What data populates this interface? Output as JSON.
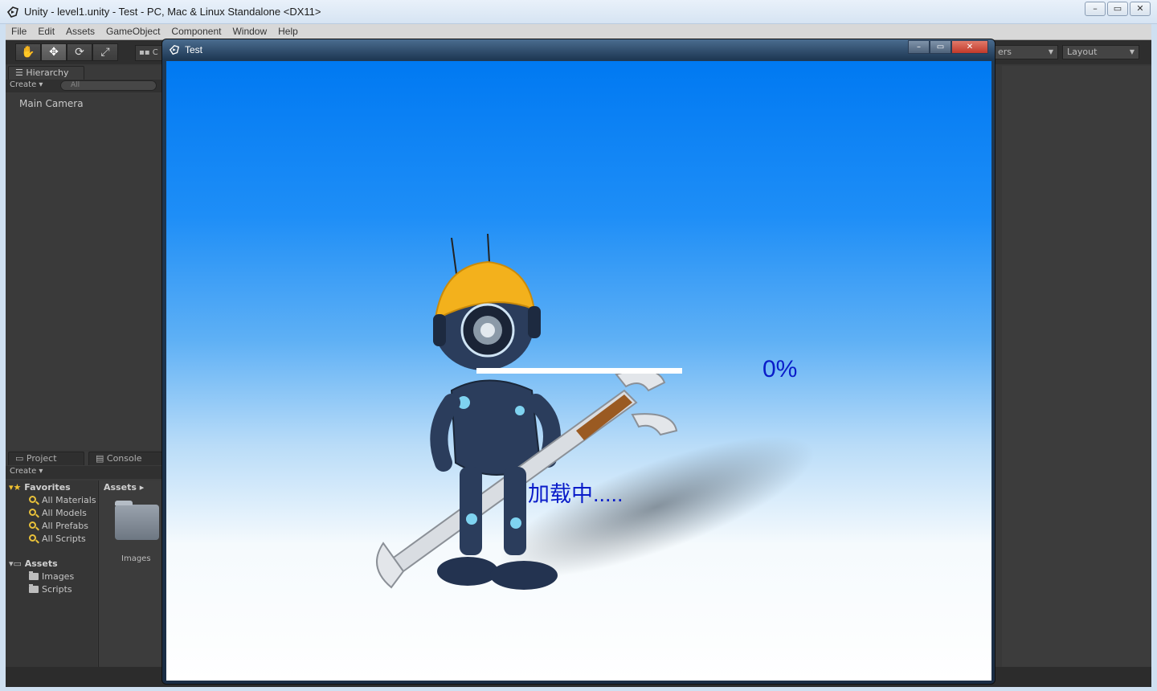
{
  "window": {
    "title": "Unity - level1.unity - Test - PC, Mac & Linux Standalone <DX11>",
    "controls": [
      "–",
      "▭",
      "✕"
    ]
  },
  "menubar": [
    "File",
    "Edit",
    "Assets",
    "GameObject",
    "Component",
    "Window",
    "Help"
  ],
  "toolbar": {
    "tools": [
      "✋",
      "✥",
      "⟳",
      "⤢"
    ],
    "pivot_label": "▪▪ C",
    "layers_label": "ers",
    "layout_label": "Layout"
  },
  "hierarchy": {
    "tab": "Hierarchy",
    "create": "Create ▾",
    "search_placeholder": "All",
    "items": [
      "Main Camera"
    ]
  },
  "project": {
    "tab": "Project",
    "console_tab": "Console",
    "create": "Create ▾",
    "favorites_label": "Favorites",
    "favorites": [
      "All Materials",
      "All Models",
      "All Prefabs",
      "All Scripts"
    ],
    "assets_label": "Assets",
    "assets_children": [
      "Images",
      "Scripts"
    ],
    "breadcrumb": "Assets ▸",
    "grid_items": [
      "Images"
    ]
  },
  "game_window": {
    "title": "Test",
    "controls": [
      "–",
      "▭",
      "✕"
    ],
    "percent_text": "0%",
    "loading_text": "加载中.....",
    "progress_fraction": 0
  },
  "colors": {
    "sky_top": "#0079f2",
    "text_blue": "#0a1cc9",
    "hard_hat": "#f3b11c",
    "robot_body": "#2b3d5c"
  }
}
